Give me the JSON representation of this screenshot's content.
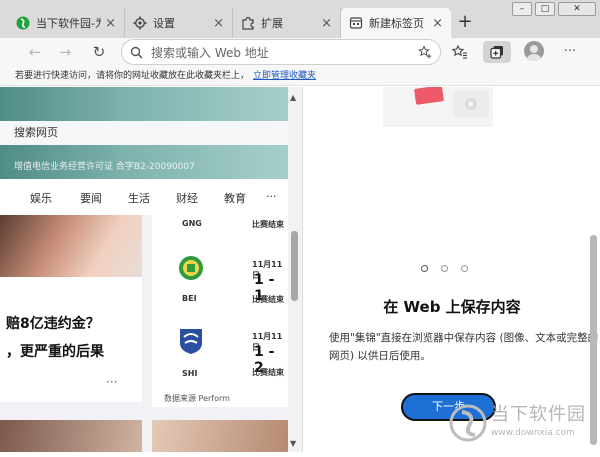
{
  "tabs": [
    {
      "label": "当下软件园-为您",
      "icon": "downxia-logo-icon",
      "active": false
    },
    {
      "label": "设置",
      "icon": "gear-icon",
      "active": false
    },
    {
      "label": "扩展",
      "icon": "puzzle-icon",
      "active": false
    },
    {
      "label": "新建标签页",
      "icon": "newtab-page-icon",
      "active": true
    }
  ],
  "tab_close": "×",
  "newtab_symbol": "+",
  "window_controls": {
    "minimize": "–",
    "maximize": "□",
    "close": "✕"
  },
  "toolbar": {
    "back": "←",
    "forward": "→",
    "refresh": "↻",
    "address_placeholder": "搜索或输入 Web 地址",
    "more": "···"
  },
  "favorites_bar": {
    "message": "若要进行快速访问，请将你的网址收藏放在此收藏夹栏上，",
    "link": "立即管理收藏夹"
  },
  "left": {
    "search_placeholder": "搜索网页",
    "icp": "增值电信业务经营许可证 合字B2-20090007",
    "nav": [
      "娱乐",
      "要闻",
      "生活",
      "财经",
      "教育",
      "···"
    ],
    "headline_lines": [
      "赔8亿违约金？",
      "，更严重的后果"
    ],
    "more": "···",
    "sports": {
      "rows": [
        {
          "team": "GNG",
          "date": "",
          "score": "",
          "status": "比赛结束"
        },
        {
          "team": "BEI",
          "date": "11月11日",
          "score": "1 - 1",
          "status": "比赛结束"
        },
        {
          "team": "SHI",
          "date": "11月11日",
          "score": "1 - 2",
          "status": "比赛结束"
        }
      ],
      "source": "数据来源 Perform"
    }
  },
  "panel": {
    "title": "在 Web 上保存内容",
    "description": "使用\"集锦\"直接在浏览器中保存内容 (图像、文本或完整的网页) 以供日后使用。",
    "next_button": "下一步"
  },
  "watermark": {
    "text": "当下软件园",
    "url": "www.downxia.com"
  }
}
